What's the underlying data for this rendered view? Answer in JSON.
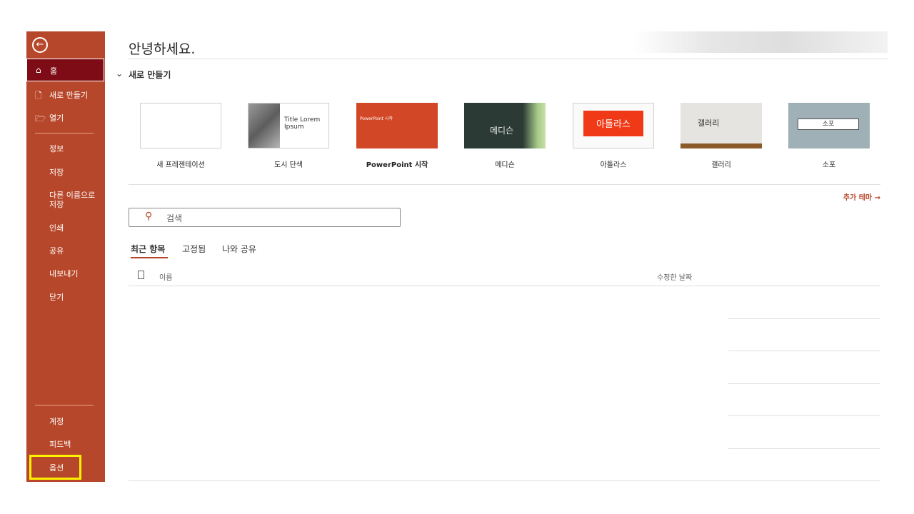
{
  "sidebar": {
    "back_icon": "back-arrow-icon",
    "home": {
      "icon": "home-icon",
      "label": "홈"
    },
    "new": {
      "icon": "new-document-icon",
      "label": "새로 만들기"
    },
    "open": {
      "icon": "folder-open-icon",
      "label": "열기"
    },
    "info": "정보",
    "save": "저장",
    "save_as": "다른 이름으로 저장",
    "print": "인쇄",
    "share": "공유",
    "export": "내보내기",
    "close": "닫기",
    "account": "계정",
    "feedback": "피드백",
    "options": "옵션",
    "accent_color": "#b7472a",
    "active_color": "#7e0c16"
  },
  "main": {
    "greeting": "안녕하세요.",
    "new_section_title": "새로 만들기",
    "templates": [
      {
        "name": "새 프레젠테이션",
        "thumb_text": ""
      },
      {
        "name": "도시 단색",
        "thumb_text": "Title Lorem Ipsum"
      },
      {
        "name": "PowerPoint 시작",
        "thumb_text": "PowerPoint 시작"
      },
      {
        "name": "메디슨",
        "thumb_text": "메디슨"
      },
      {
        "name": "아틀라스",
        "thumb_text": "아틀라스"
      },
      {
        "name": "갤러리",
        "thumb_text": "갤러리"
      },
      {
        "name": "소포",
        "thumb_text": "소포"
      }
    ],
    "more_themes": "추가 테마 →",
    "search_placeholder": "검색",
    "tabs": [
      "최근 항목",
      "고정됨",
      "나와 공유"
    ],
    "columns": {
      "name": "이름",
      "modified": "수정한 날짜"
    }
  }
}
